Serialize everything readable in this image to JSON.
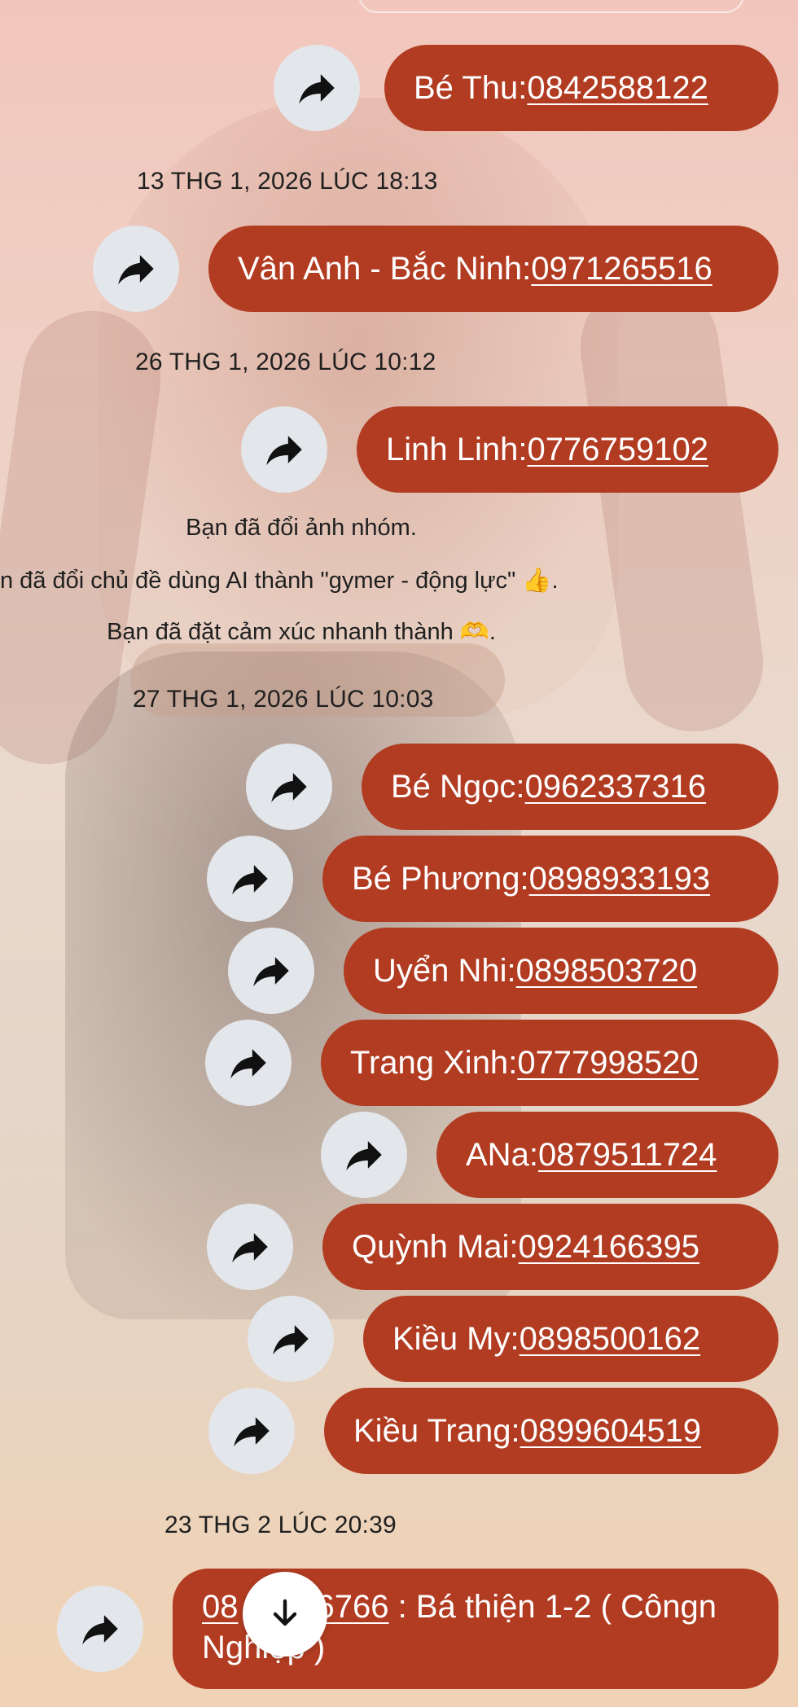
{
  "messages": [
    {
      "name": "Bé Thu",
      "sep": " : ",
      "phone": "0842588122"
    },
    {
      "timestamp": "13 THG 1, 2026 LÚC 18:13"
    },
    {
      "name": "Vân Anh - Bắc Ninh",
      "sep": " :",
      "phone": "0971265516"
    },
    {
      "timestamp": "26 THG 1, 2026 LÚC 10:12"
    },
    {
      "name": "Linh Linh",
      "sep": " : ",
      "phone": "0776759102"
    }
  ],
  "system": {
    "photo_changed": "Bạn đã đổi ảnh nhóm.",
    "theme_changed": "n đã đổi chủ đề dùng AI thành \"gymer - động lực\" 👍.",
    "reaction_set": "Bạn đã đặt cảm xúc nhanh thành 🫶."
  },
  "timestamps": {
    "t1": "13 THG 1, 2026 LÚC 18:13",
    "t2": "26 THG 1, 2026 LÚC 10:12",
    "t3": "27 THG 1, 2026 LÚC 10:03",
    "t4": "23 THG 2 LÚC 20:39"
  },
  "contacts": {
    "be_thu": {
      "name": "Bé Thu",
      "sep": " : ",
      "phone": "0842588122"
    },
    "van_anh": {
      "name": "Vân Anh - Bắc Ninh",
      "sep": " :",
      "phone": "0971265516"
    },
    "linh_linh": {
      "name": "Linh Linh",
      "sep": " : ",
      "phone": "0776759102"
    },
    "be_ngoc": {
      "name": "Bé Ngọc",
      "sep": " : ",
      "phone": "0962337316"
    },
    "be_phuong": {
      "name": "Bé Phương",
      "sep": " : ",
      "phone": "0898933193"
    },
    "uyen_nhi": {
      "name": "Uyển Nhi",
      "sep": " : ",
      "phone": "0898503720"
    },
    "trang_xinh": {
      "name": "Trang Xinh",
      "sep": " : ",
      "phone": "0777998520"
    },
    "ana": {
      "name": "ANa",
      "sep": " : ",
      "phone": "0879511724"
    },
    "quynh_mai": {
      "name": "Quỳnh Mai",
      "sep": " : ",
      "phone": "0924166395"
    },
    "kieu_my": {
      "name": "Kiều My",
      "sep": " : ",
      "phone": "0898500162"
    },
    "kieu_trang": {
      "name": "Kiều Trang",
      "sep": " : ",
      "phone": "0899604519"
    }
  },
  "last_message": {
    "phone_visible": "08",
    "phone_visible_end": "6766",
    "text": " : Bá thiện 1-2 ( Côngn",
    "text_line2": "Nghiệp )"
  },
  "icons": {
    "share": "share-arrow-icon",
    "scroll": "arrow-down-icon"
  },
  "colors": {
    "bubble": "#b23c22",
    "share_bg": "#e3e6ea",
    "text_dark": "#1f1f1f"
  }
}
